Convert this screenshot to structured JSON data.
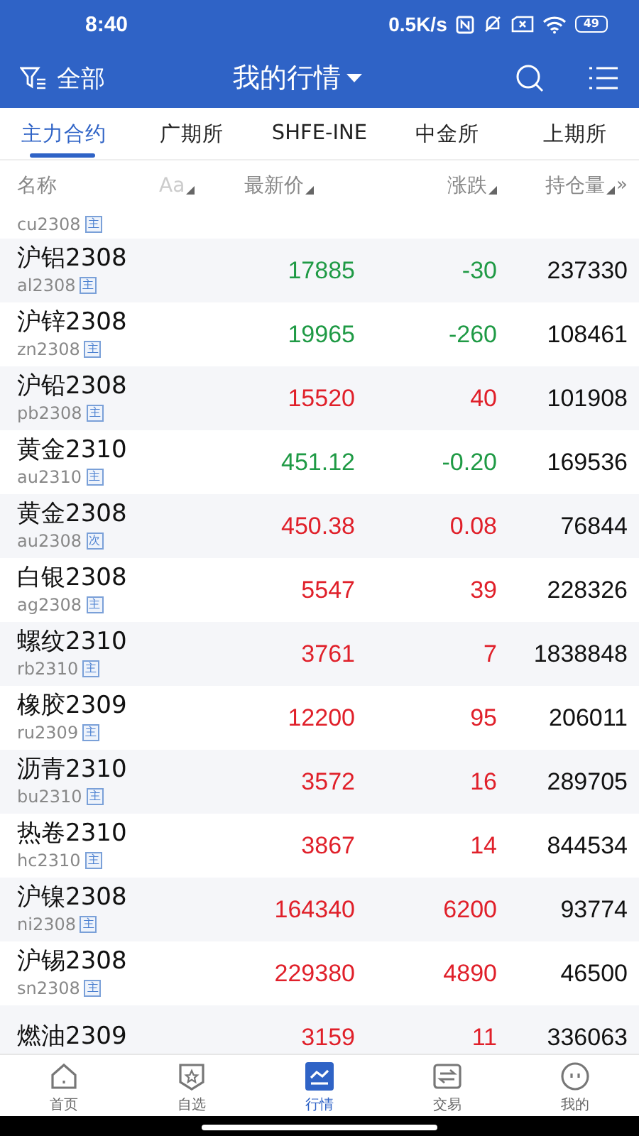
{
  "status_bar": {
    "time": "8:40",
    "speed": "0.5K/s",
    "battery": "49"
  },
  "header": {
    "filter_label": "全部",
    "title": "我的行情"
  },
  "tabs": [
    {
      "label": "主力合约",
      "selected": true
    },
    {
      "label": "广期所",
      "selected": false
    },
    {
      "label": "SHFE-INE",
      "selected": false
    },
    {
      "label": "中金所",
      "selected": false
    },
    {
      "label": "上期所",
      "selected": false
    }
  ],
  "columns": {
    "name": "名称",
    "font_toggle": "Aa",
    "price": "最新价",
    "change": "涨跌",
    "open_interest": "持仓量",
    "more": "»"
  },
  "rows": [
    {
      "kind": "partial",
      "code": "cu2308",
      "badge": "主"
    },
    {
      "kind": "full",
      "name": "沪铝2308",
      "code": "al2308",
      "badge": "主",
      "color": "#1f9a45",
      "price": "17885",
      "change": "-30",
      "open_interest": "237330"
    },
    {
      "kind": "full",
      "name": "沪锌2308",
      "code": "zn2308",
      "badge": "主",
      "color": "#1f9a45",
      "price": "19965",
      "change": "-260",
      "open_interest": "108461"
    },
    {
      "kind": "full",
      "name": "沪铅2308",
      "code": "pb2308",
      "badge": "主",
      "color": "#e0202a",
      "price": "15520",
      "change": "40",
      "open_interest": "101908"
    },
    {
      "kind": "full",
      "name": "黄金2310",
      "code": "au2310",
      "badge": "主",
      "color": "#1f9a45",
      "price": "451.12",
      "change": "-0.20",
      "open_interest": "169536"
    },
    {
      "kind": "full",
      "name": "黄金2308",
      "code": "au2308",
      "badge": "次",
      "color": "#e0202a",
      "price": "450.38",
      "change": "0.08",
      "open_interest": "76844"
    },
    {
      "kind": "full",
      "name": "白银2308",
      "code": "ag2308",
      "badge": "主",
      "color": "#e0202a",
      "price": "5547",
      "change": "39",
      "open_interest": "228326"
    },
    {
      "kind": "full",
      "name": "螺纹2310",
      "code": "rb2310",
      "badge": "主",
      "color": "#e0202a",
      "price": "3761",
      "change": "7",
      "open_interest": "1838848"
    },
    {
      "kind": "full",
      "name": "橡胶2309",
      "code": "ru2309",
      "badge": "主",
      "color": "#e0202a",
      "price": "12200",
      "change": "95",
      "open_interest": "206011"
    },
    {
      "kind": "full",
      "name": "沥青2310",
      "code": "bu2310",
      "badge": "主",
      "color": "#e0202a",
      "price": "3572",
      "change": "16",
      "open_interest": "289705"
    },
    {
      "kind": "full",
      "name": "热卷2310",
      "code": "hc2310",
      "badge": "主",
      "color": "#e0202a",
      "price": "3867",
      "change": "14",
      "open_interest": "844534"
    },
    {
      "kind": "full",
      "name": "沪镍2308",
      "code": "ni2308",
      "badge": "主",
      "color": "#e0202a",
      "price": "164340",
      "change": "6200",
      "open_interest": "93774"
    },
    {
      "kind": "full",
      "name": "沪锡2308",
      "code": "sn2308",
      "badge": "主",
      "color": "#e0202a",
      "price": "229380",
      "change": "4890",
      "open_interest": "46500"
    },
    {
      "kind": "full",
      "name": "燃油2309",
      "color": "#e0202a",
      "price": "3159",
      "change": "11",
      "open_interest": "336063"
    }
  ],
  "bottom_nav": [
    {
      "label": "首页",
      "selected": false
    },
    {
      "label": "自选",
      "selected": false
    },
    {
      "label": "行情",
      "selected": true
    },
    {
      "label": "交易",
      "selected": false
    },
    {
      "label": "我的",
      "selected": false
    }
  ]
}
